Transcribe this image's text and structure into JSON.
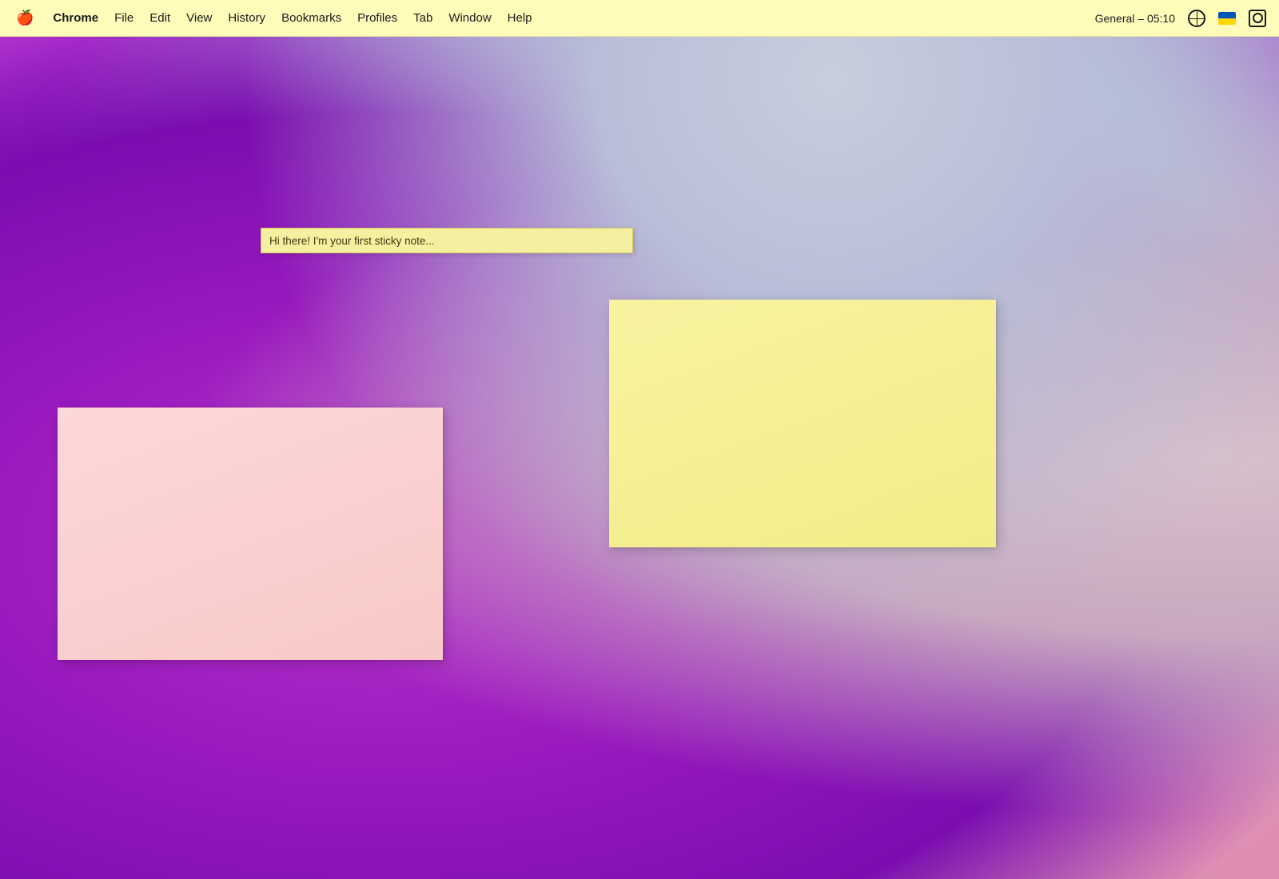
{
  "menubar": {
    "apple_label": "",
    "items": [
      {
        "id": "chrome",
        "label": "Chrome",
        "bold": true
      },
      {
        "id": "file",
        "label": "File"
      },
      {
        "id": "edit",
        "label": "Edit"
      },
      {
        "id": "view",
        "label": "View"
      },
      {
        "id": "history",
        "label": "History"
      },
      {
        "id": "bookmarks",
        "label": "Bookmarks"
      },
      {
        "id": "profiles",
        "label": "Profiles"
      },
      {
        "id": "tab",
        "label": "Tab"
      },
      {
        "id": "window",
        "label": "Window"
      },
      {
        "id": "help",
        "label": "Help"
      }
    ],
    "status": {
      "time_label": "General – 05:10"
    }
  },
  "sticky_notes": {
    "small": {
      "text": "Hi there! I'm your first sticky note...",
      "color": "#f5f0a0"
    },
    "yellow": {
      "text": "",
      "color": "#f5f060"
    },
    "pink": {
      "text": "",
      "color": "#fdd8d8"
    }
  },
  "desktop": {
    "background_colors": [
      "#cc44dd",
      "#7700aa",
      "#ccaacc"
    ]
  }
}
